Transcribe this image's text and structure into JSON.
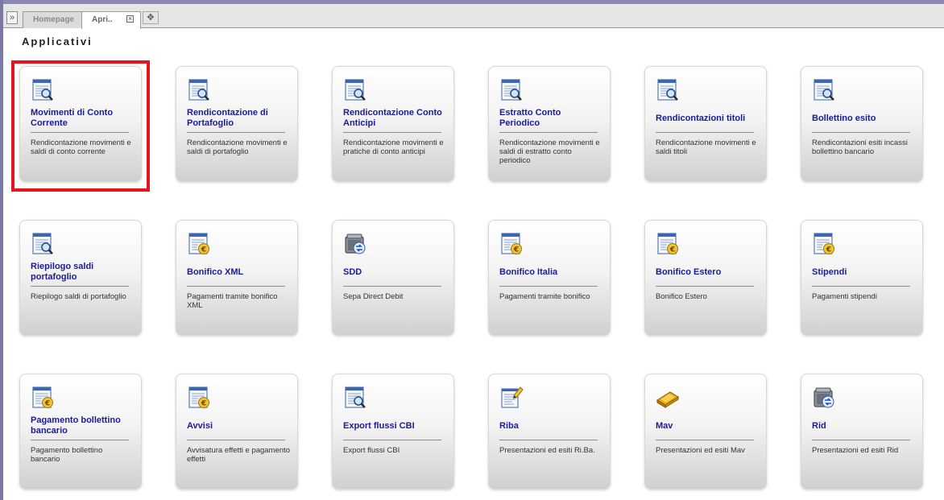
{
  "tabs": {
    "nav_button_glyph": "»",
    "items": [
      {
        "label": "Homepage"
      },
      {
        "label": "Apri..",
        "close": "×"
      }
    ],
    "move_glyph": "✥"
  },
  "page_title": "Applicativi",
  "highlight_color": "#e8141c",
  "tiles": [
    {
      "title": "Movimenti di Conto Corrente",
      "desc": "Rendicontazione movimenti e saldi di conto corrente",
      "icon": "document-search-icon"
    },
    {
      "title": "Rendicontazione di Portafoglio",
      "desc": "Rendicontazione movimenti e saldi di portafoglio",
      "icon": "document-search-icon"
    },
    {
      "title": "Rendicontazione Conto Anticipi",
      "desc": "Rendicontazione movimenti e pratiche di conto anticipi",
      "icon": "document-search-icon"
    },
    {
      "title": "Estratto Conto Periodico",
      "desc": "Rendicontazione movimenti e saldi di estratto conto periodico",
      "icon": "document-search-icon"
    },
    {
      "title": "Rendicontazioni titoli",
      "desc": "Rendicontazione movimenti e saldi titoli",
      "icon": "document-search-icon"
    },
    {
      "title": "Bollettino esito",
      "desc": "Rendicontazioni esiti incassi bollettino bancario",
      "icon": "document-search-icon"
    },
    {
      "title": "Riepilogo saldi portafoglio",
      "desc": "Riepilogo saldi di portafoglio",
      "icon": "document-search-icon"
    },
    {
      "title": "Bonifico XML",
      "desc": "Pagamenti tramite bonifico XML",
      "icon": "document-euro-icon"
    },
    {
      "title": "SDD",
      "desc": "Sepa Direct Debit",
      "icon": "safe-transfer-icon"
    },
    {
      "title": "Bonifico Italia",
      "desc": "Pagamenti tramite bonifico",
      "icon": "document-euro-icon"
    },
    {
      "title": "Bonifico Estero",
      "desc": "Bonifico Estero",
      "icon": "document-euro-icon"
    },
    {
      "title": "Stipendi",
      "desc": "Pagamenti stipendi",
      "icon": "document-euro-icon"
    },
    {
      "title": "Pagamento bollettino bancario",
      "desc": "Pagamento bollettino bancario",
      "icon": "document-euro-icon"
    },
    {
      "title": "Avvisi",
      "desc": "Avvisatura effetti e pagamento effetti",
      "icon": "document-euro-icon"
    },
    {
      "title": "Export flussi CBI",
      "desc": "Export flussi CBI",
      "icon": "document-search-icon"
    },
    {
      "title": "Riba",
      "desc": "Presentazioni ed esiti Ri.Ba.",
      "icon": "document-edit-icon"
    },
    {
      "title": "Mav",
      "desc": "Presentazioni ed esiti Mav",
      "icon": "gold-bar-icon"
    },
    {
      "title": "Rid",
      "desc": "Presentazioni ed esiti Rid",
      "icon": "safe-transfer-icon"
    }
  ]
}
